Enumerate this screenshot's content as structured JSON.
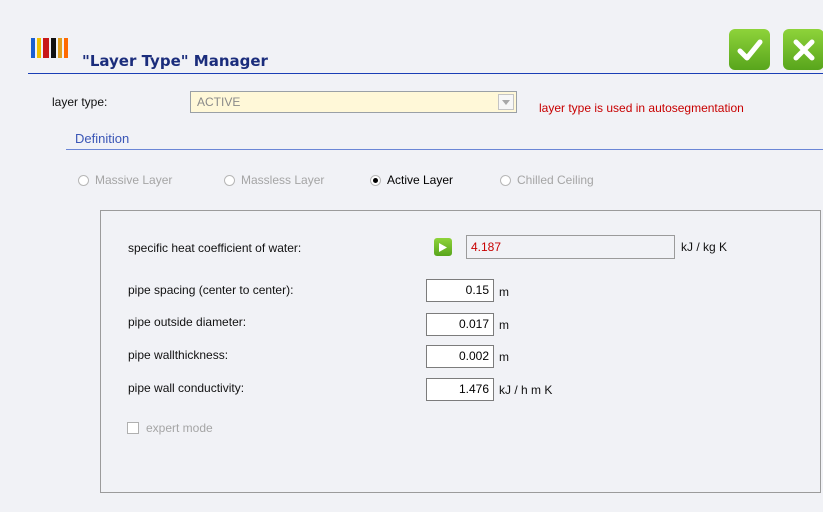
{
  "header": {
    "title": "\"Layer Type\" Manager",
    "logo_colors": [
      "#1a5fd0",
      "#f0c000",
      "#c81818",
      "#111111",
      "#e0a020",
      "#ff6a00"
    ],
    "ok_icon": "check-icon",
    "cancel_icon": "close-icon"
  },
  "layer_type": {
    "label": "layer type:",
    "value": "ACTIVE",
    "warning": "layer type is used in autosegmentation"
  },
  "definition": {
    "title": "Definition",
    "options": [
      {
        "label": "Massive Layer",
        "selected": false,
        "enabled": false
      },
      {
        "label": "Massless Layer",
        "selected": false,
        "enabled": false
      },
      {
        "label": "Active Layer",
        "selected": true,
        "enabled": true
      },
      {
        "label": "Chilled Ceiling",
        "selected": false,
        "enabled": false
      }
    ]
  },
  "params": {
    "heat_label": "specific heat coefficient of water:",
    "heat_value": "4.187",
    "heat_unit": "kJ / kg K",
    "rows": [
      {
        "label": "pipe spacing (center to center):",
        "value": "0.15",
        "unit": "m"
      },
      {
        "label": "pipe outside diameter:",
        "value": "0.017",
        "unit": "m"
      },
      {
        "label": "pipe wallthickness:",
        "value": "0.002",
        "unit": "m"
      },
      {
        "label": "pipe wall conductivity:",
        "value": "1.476",
        "unit": "kJ / h m K"
      }
    ],
    "expert_label": "expert mode",
    "expert_checked": false
  },
  "colors": {
    "accent_green": "#6cbf2a",
    "title_blue": "#1b2d7c",
    "warning_red": "#c80000"
  }
}
